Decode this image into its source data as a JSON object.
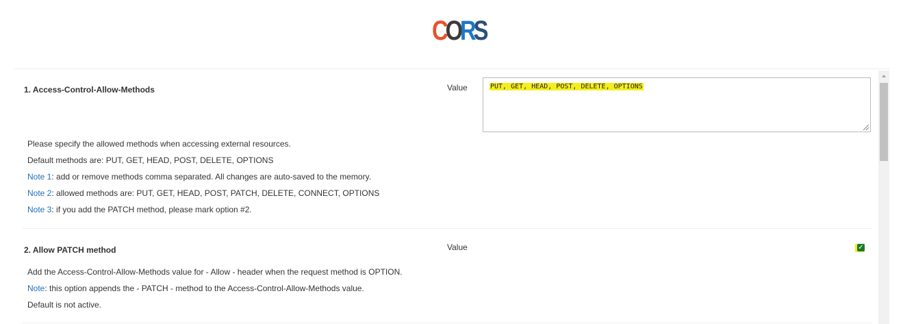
{
  "logo": {
    "text": "CORS",
    "parts": [
      "C",
      "O",
      "R",
      "S"
    ],
    "colors": [
      "#e8512b",
      "#3b3b3b",
      "#1f77c5",
      "#2c4f7a"
    ]
  },
  "sections": [
    {
      "title": "1. Access-Control-Allow-Methods",
      "value_label": "Value",
      "value": "PUT, GET, HEAD, POST, DELETE, OPTIONS",
      "lines": [
        {
          "note": "",
          "text": "Please specify the allowed methods when accessing external resources."
        },
        {
          "note": "",
          "text": "Default methods are: PUT, GET, HEAD, POST, DELETE, OPTIONS"
        },
        {
          "note": "Note 1",
          "text": ": add or remove methods comma separated. All changes are auto-saved to the memory."
        },
        {
          "note": "Note 2",
          "text": ": allowed methods are: PUT, GET, HEAD, POST, PATCH, DELETE, CONNECT, OPTIONS"
        },
        {
          "note": "Note 3",
          "text": ": if you add the PATCH method, please mark option #2."
        }
      ]
    },
    {
      "title": "2. Allow PATCH method",
      "value_label": "Value",
      "checked": true,
      "lines": [
        {
          "note": "",
          "text": "Add the Access-Control-Allow-Methods value for - Allow - header when the request method is OPTION."
        },
        {
          "note": "Note",
          "text": ": this option appends the - PATCH - method to the Access-Control-Allow-Methods value."
        },
        {
          "note": "",
          "text": "Default is not active."
        }
      ]
    }
  ],
  "colors": {
    "highlight": "#f5ee1d",
    "note_link": "#1f6fb2",
    "checkbox": "#1a7a2e"
  }
}
